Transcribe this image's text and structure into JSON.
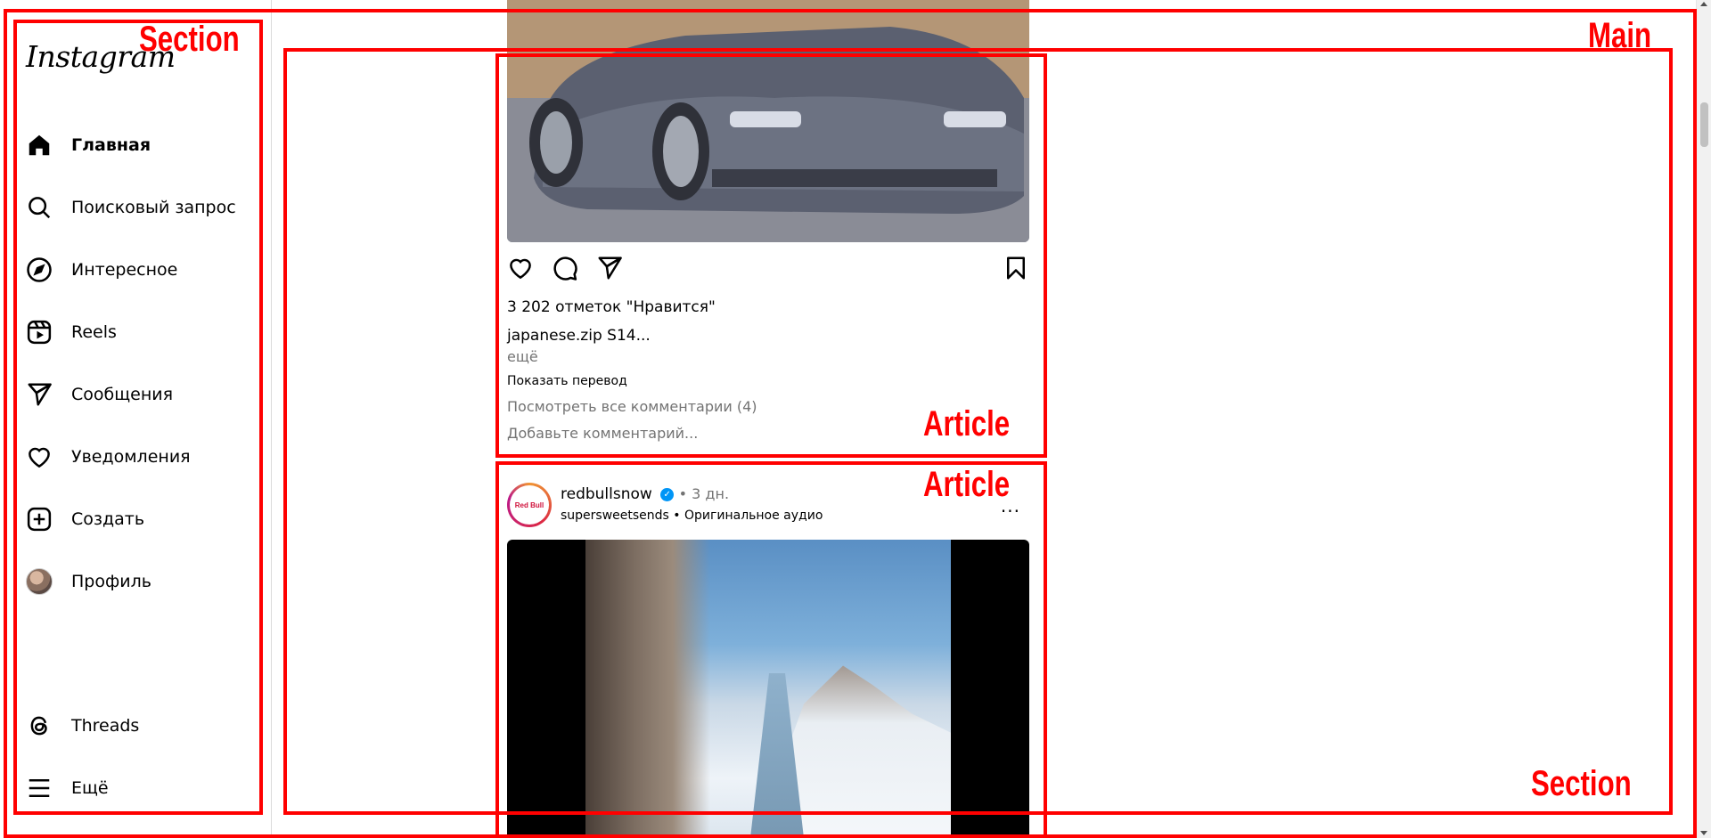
{
  "sidebar": {
    "logo": "Instagram",
    "items": [
      {
        "label": "Главная",
        "icon": "home-icon"
      },
      {
        "label": "Поисковый запрос",
        "icon": "search-icon"
      },
      {
        "label": "Интересное",
        "icon": "compass-icon"
      },
      {
        "label": "Reels",
        "icon": "reels-icon"
      },
      {
        "label": "Сообщения",
        "icon": "send-icon"
      },
      {
        "label": "Уведомления",
        "icon": "heart-icon"
      },
      {
        "label": "Создать",
        "icon": "plus-square-icon"
      },
      {
        "label": "Профиль",
        "icon": "avatar"
      }
    ],
    "bottom_items": [
      {
        "label": "Threads",
        "icon": "threads-icon"
      },
      {
        "label": "Ещё",
        "icon": "menu-icon"
      }
    ]
  },
  "post1": {
    "likes": "3 202 отметок \"Нравится\"",
    "username": "japanese.zip",
    "caption": "S14...",
    "more": "ещё",
    "translate": "Показать перевод",
    "view_comments": "Посмотреть все комментарии (4)",
    "add_comment_placeholder": "Добавьте комментарий..."
  },
  "post2": {
    "username": "redbullsnow",
    "time": "• 3 дн.",
    "audio": "supersweetsends • Оригинальное аудио",
    "avatar_text": "Red Bull",
    "menu": "..."
  },
  "annotations": {
    "section_left": "Section",
    "main": "Main",
    "article1": "Article",
    "article2": "Article",
    "section_right": "Section"
  },
  "colors": {
    "annotation": "#ff0000",
    "muted_text": "#737373",
    "verified": "#0095f6"
  }
}
